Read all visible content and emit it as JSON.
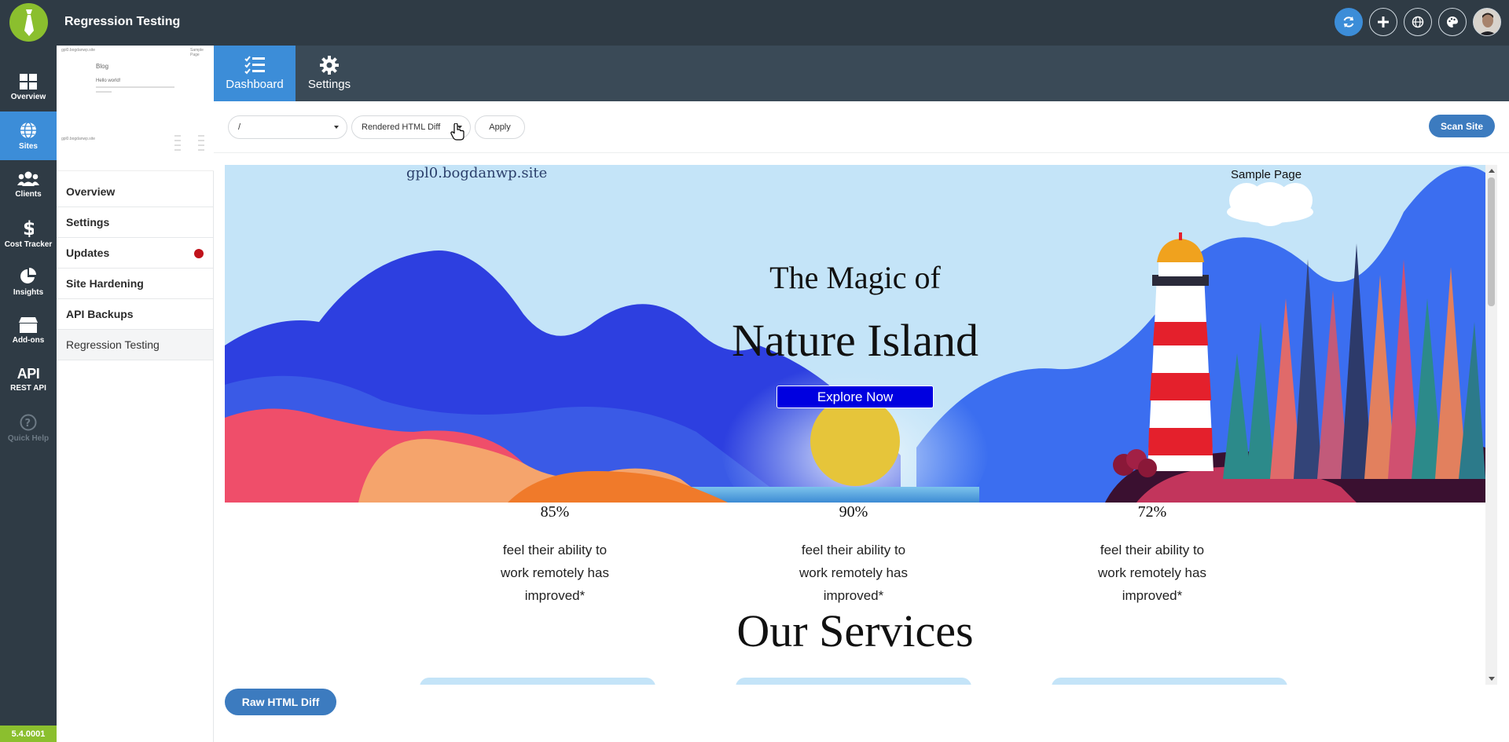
{
  "app": {
    "title": "Regression Testing",
    "version": "5.4.0001"
  },
  "topbar": {
    "icons": [
      "sync-icon",
      "plus-icon",
      "globe-icon",
      "palette-icon",
      "user-avatar"
    ]
  },
  "leftnav": {
    "items": [
      {
        "label": "Overview",
        "icon": "grid-icon"
      },
      {
        "label": "Sites",
        "icon": "globe-icon",
        "active": true
      },
      {
        "label": "Clients",
        "icon": "users-icon"
      },
      {
        "label": "Cost Tracker",
        "icon": "dollar-icon"
      },
      {
        "label": "Insights",
        "icon": "pie-chart-icon"
      },
      {
        "label": "Add-ons",
        "icon": "box-icon"
      },
      {
        "label": "REST API",
        "icon_text": "API"
      },
      {
        "label": "Quick Help",
        "icon": "question-icon"
      }
    ]
  },
  "thumbnail": {
    "site": "gpl0.bogdanwp.site",
    "blog": "Blog",
    "post": "Hello world!",
    "menu": "Sample Page"
  },
  "sitemenu": {
    "items": [
      {
        "label": "Overview"
      },
      {
        "label": "Settings"
      },
      {
        "label": "Updates",
        "has_alert": true
      },
      {
        "label": "Site Hardening"
      },
      {
        "label": "API Backups"
      },
      {
        "label": "Regression Testing",
        "active": true
      }
    ]
  },
  "tabs": [
    {
      "label": "Dashboard",
      "icon": "checklist-icon",
      "active": true
    },
    {
      "label": "Settings",
      "icon": "gear-icon"
    }
  ],
  "filters": {
    "path_value": "/",
    "mode_value": "Rendered HTML Diff",
    "apply_label": "Apply",
    "scan_label": "Scan Site"
  },
  "preview": {
    "site_name": "gpl0.bogdanwp.site",
    "nav_link": "Sample Page",
    "hero_subtitle": "The Magic of",
    "hero_title": "Nature Island",
    "cta_label": "Explore Now",
    "stats": [
      {
        "pct": "85%",
        "desc_1": "feel their ability to",
        "desc_2": "work remotely has",
        "desc_3": "improved*"
      },
      {
        "pct": "90%",
        "desc_1": "feel their ability to",
        "desc_2": "work remotely has",
        "desc_3": "improved*"
      },
      {
        "pct": "72%",
        "desc_1": "feel their ability to",
        "desc_2": "work remotely has",
        "desc_3": "improved*"
      }
    ],
    "services_heading": "Our Services"
  },
  "footer": {
    "raw_diff_label": "Raw HTML Diff"
  },
  "colors": {
    "accent": "#3c8dd8",
    "navbg": "#2f3b45",
    "brand": "#8bbf2e",
    "alert": "#c0121b"
  }
}
